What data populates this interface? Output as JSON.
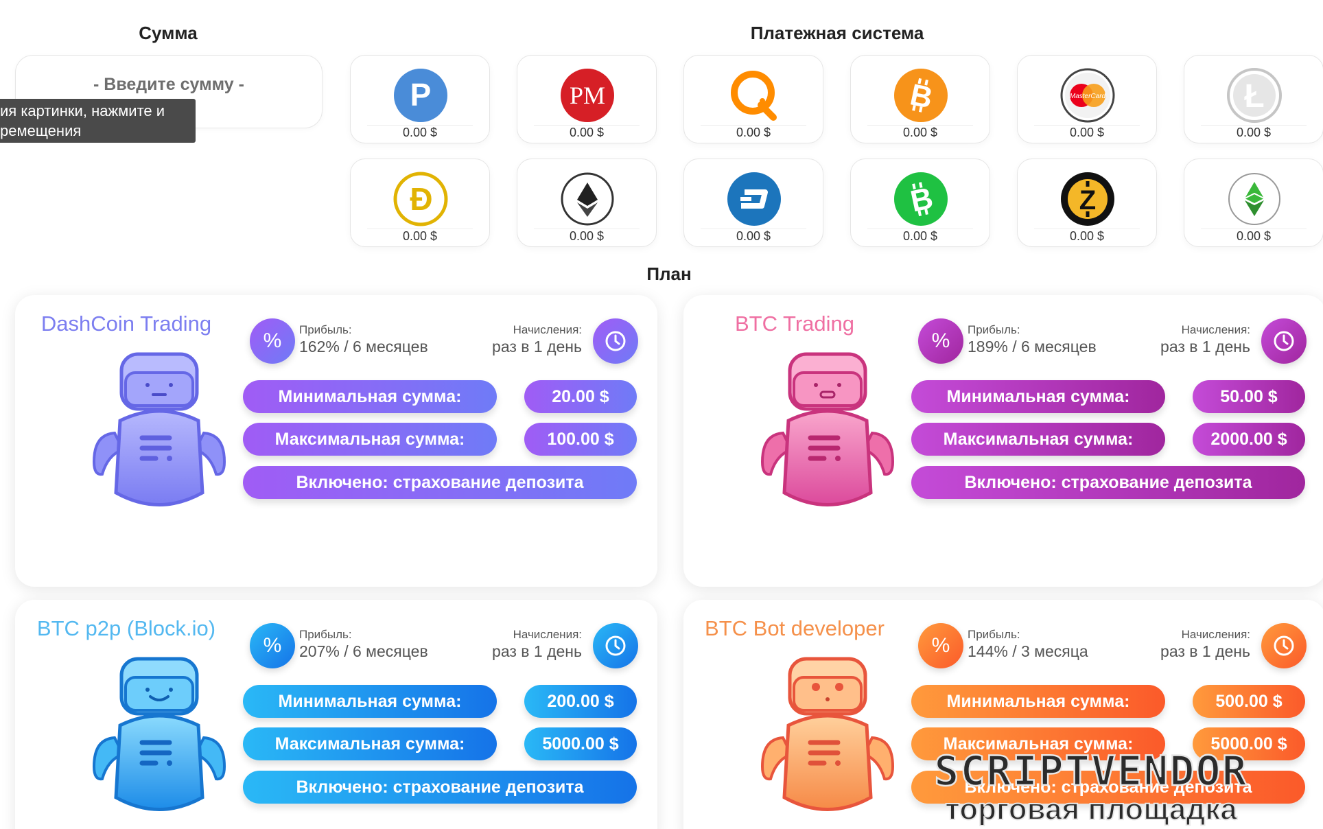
{
  "amount": {
    "title": "Сумма",
    "placeholder": "- Введите сумму -"
  },
  "tooltip": {
    "line1": "ия картинки, нажмите и",
    "line2": "ремещения"
  },
  "payment": {
    "title": "Платежная система",
    "systems": [
      {
        "name": "Payeer",
        "icon": "payeer-icon",
        "balance": "0.00 $",
        "color": "#4a8cd8"
      },
      {
        "name": "Perfect Money",
        "icon": "perfect-money-icon",
        "balance": "0.00 $",
        "color": "#d61f26"
      },
      {
        "name": "QIWI",
        "icon": "qiwi-icon",
        "balance": "0.00 $",
        "color": "#ff8c00"
      },
      {
        "name": "Bitcoin",
        "icon": "bitcoin-icon",
        "balance": "0.00 $",
        "color": "#f7931a"
      },
      {
        "name": "MasterCard",
        "icon": "mastercard-icon",
        "balance": "0.00 $",
        "color": "#eb001b"
      },
      {
        "name": "Litecoin",
        "icon": "litecoin-icon",
        "balance": "0.00 $",
        "color": "#c0c0c0"
      },
      {
        "name": "Dogecoin",
        "icon": "dogecoin-icon",
        "balance": "0.00 $",
        "color": "#e1b303"
      },
      {
        "name": "Ethereum",
        "icon": "ethereum-icon",
        "balance": "0.00 $",
        "color": "#3c3c3d"
      },
      {
        "name": "Dash",
        "icon": "dash-icon",
        "balance": "0.00 $",
        "color": "#1c75bc"
      },
      {
        "name": "Bitcoin Cash",
        "icon": "bitcoin-cash-icon",
        "balance": "0.00 $",
        "color": "#1fc142"
      },
      {
        "name": "Zcash",
        "icon": "zcash-icon",
        "balance": "0.00 $",
        "color": "#f4b728"
      },
      {
        "name": "Ethereum Classic",
        "icon": "ethereum-classic-icon",
        "balance": "0.00 $",
        "color": "#3ab83a"
      }
    ]
  },
  "plan": {
    "title": "План",
    "cards": [
      {
        "name": "DashCoin Trading",
        "name_color": "#7c7ef0",
        "profit_label": "Прибыль:",
        "profit_value": "162% / 6 месяцев",
        "accrual_label": "Начисления:",
        "accrual_value": "раз в 1 день",
        "min_label": "Минимальная сумма:",
        "min_value": "20.00 $",
        "max_label": "Максимальная сумма:",
        "max_value": "100.00 $",
        "insurance": "Включено: страхование депозита",
        "color_a": "#a05cf5",
        "color_b": "#6f7bf7",
        "robot_light": "#a6a8fb",
        "robot_dark": "#7173f0"
      },
      {
        "name": "BTC Trading",
        "name_color": "#ef6fa2",
        "profit_label": "Прибыль:",
        "profit_value": "189% / 6 месяцев",
        "accrual_label": "Начисления:",
        "accrual_value": "раз в 1 день",
        "min_label": "Минимальная сумма:",
        "min_value": "50.00 $",
        "max_label": "Максимальная сумма:",
        "max_value": "2000.00 $",
        "insurance": "Включено: страхование депозита",
        "color_a": "#c44bd8",
        "color_b": "#a0269e",
        "robot_light": "#f59ac4",
        "robot_dark": "#dd4f8f"
      },
      {
        "name": "BTC p2p (Block.io)",
        "name_color": "#53b8f0",
        "profit_label": "Прибыль:",
        "profit_value": "207% / 6 месяцев",
        "accrual_label": "Начисления:",
        "accrual_value": "раз в 1 день",
        "min_label": "Минимальная сумма:",
        "min_value": "200.00 $",
        "max_label": "Максимальная сумма:",
        "max_value": "5000.00 $",
        "insurance": "Включено: страхование депозита",
        "color_a": "#2ab8f6",
        "color_b": "#1573e8",
        "robot_light": "#7fd3fb",
        "robot_dark": "#1f8fe6"
      },
      {
        "name": "BTC Bot developer",
        "name_color": "#f5904a",
        "profit_label": "Прибыль:",
        "profit_value": "144% / 3 месяца",
        "accrual_label": "Начисления:",
        "accrual_value": "раз в 1 день",
        "min_label": "Минимальная сумма:",
        "min_value": "500.00 $",
        "max_label": "Максимальная сумма:",
        "max_value": "5000.00 $",
        "insurance": "Включено: страхование депозита",
        "color_a": "#ff9a3c",
        "color_b": "#fb5a2a",
        "robot_light": "#ffc48a",
        "robot_dark": "#f06a4a"
      }
    ]
  },
  "watermark": {
    "brand": "SCRIPTVENDOR",
    "tagline": "торговая площадка"
  }
}
